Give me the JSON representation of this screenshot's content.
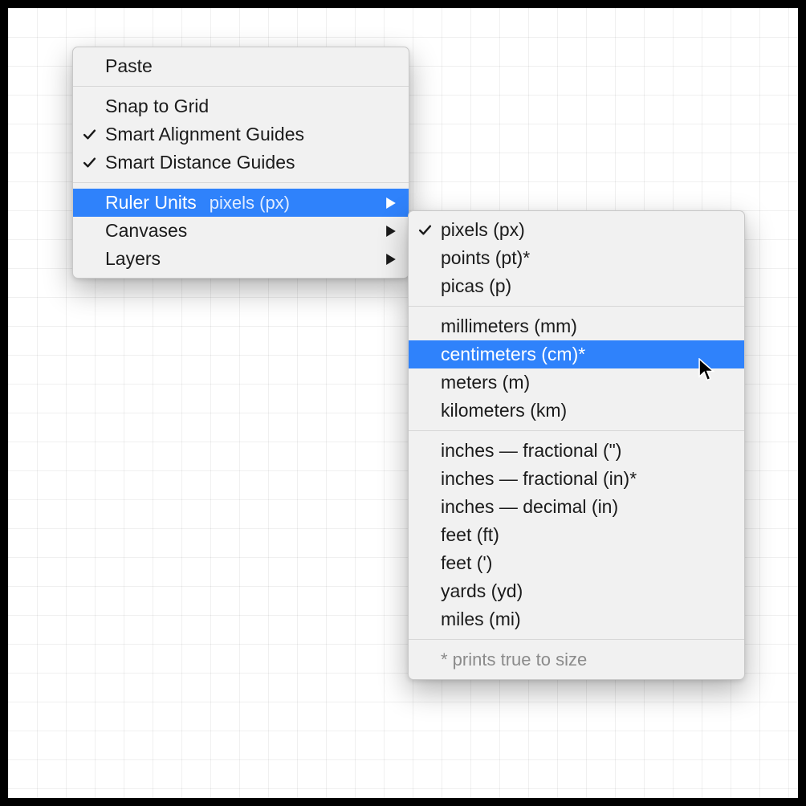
{
  "main_menu": {
    "paste": "Paste",
    "snap_to_grid": "Snap to Grid",
    "smart_alignment": "Smart Alignment Guides",
    "smart_distance": "Smart Distance Guides",
    "ruler_units": "Ruler Units",
    "ruler_units_hint": "pixels (px)",
    "canvases": "Canvases",
    "layers": "Layers"
  },
  "unit_menu": {
    "pixels": "pixels (px)",
    "points": "points (pt)*",
    "picas": "picas (p)",
    "millimeters": "millimeters (mm)",
    "centimeters": "centimeters (cm)*",
    "meters": "meters (m)",
    "kilometers": "kilometers (km)",
    "inches_frac_quote": "inches — fractional (\")",
    "inches_frac_in": "inches — fractional (in)*",
    "inches_dec": "inches — decimal (in)",
    "feet_ft": "feet (ft)",
    "feet_quote": "feet (')",
    "yards": "yards (yd)",
    "miles": "miles (mi)",
    "footnote": "* prints true to size"
  }
}
